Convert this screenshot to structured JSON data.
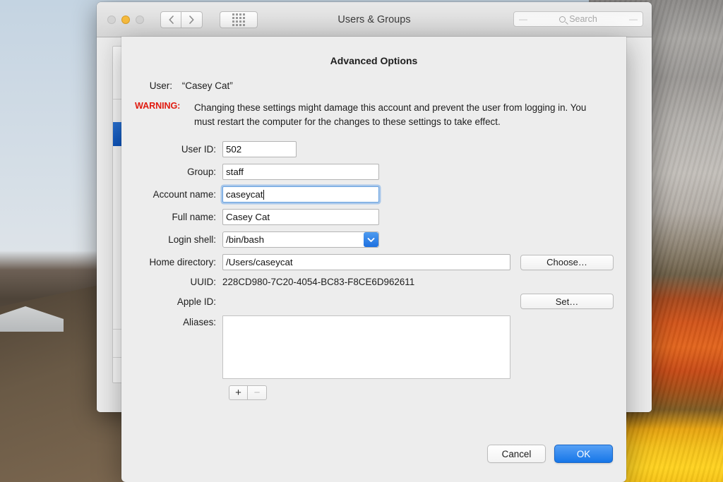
{
  "window": {
    "title": "Users & Groups",
    "traffic_lights": [
      "close-button",
      "minimize-button",
      "zoom-button"
    ],
    "back_label": "‹",
    "forward_label": "›",
    "grid_label": "show-all-grid"
  },
  "search": {
    "placeholder": "Search",
    "value": ""
  },
  "sheet": {
    "title": "Advanced Options",
    "user_label": "User:",
    "user_value": "“Casey Cat”",
    "warning_label": "WARNING:",
    "warning_text": "Changing these settings might damage this account and prevent the user from logging in. You must restart the computer for the changes to these settings to take effect.",
    "fields": {
      "user_id": {
        "label": "User ID:",
        "value": "502"
      },
      "group": {
        "label": "Group:",
        "value": "staff"
      },
      "account_name": {
        "label": "Account name:",
        "value": "caseycat"
      },
      "full_name": {
        "label": "Full name:",
        "value": "Casey Cat"
      },
      "login_shell": {
        "label": "Login shell:",
        "value": "/bin/bash"
      },
      "home_directory": {
        "label": "Home directory:",
        "value": "/Users/caseycat"
      },
      "uuid": {
        "label": "UUID:",
        "value": "228CD980-7C20-4054-BC83-F8CE6D962611"
      },
      "apple_id": {
        "label": "Apple ID:",
        "value": ""
      },
      "aliases": {
        "label": "Aliases:",
        "items": []
      }
    },
    "buttons": {
      "choose": "Choose…",
      "set": "Set…",
      "add_alias": "+",
      "remove_alias": "−",
      "cancel": "Cancel",
      "ok": "OK"
    }
  },
  "colors": {
    "accent_blue": "#1676e8",
    "warning_red": "#e01b10",
    "sheet_bg": "#ededed",
    "selection_blue": "#0c55c0"
  }
}
